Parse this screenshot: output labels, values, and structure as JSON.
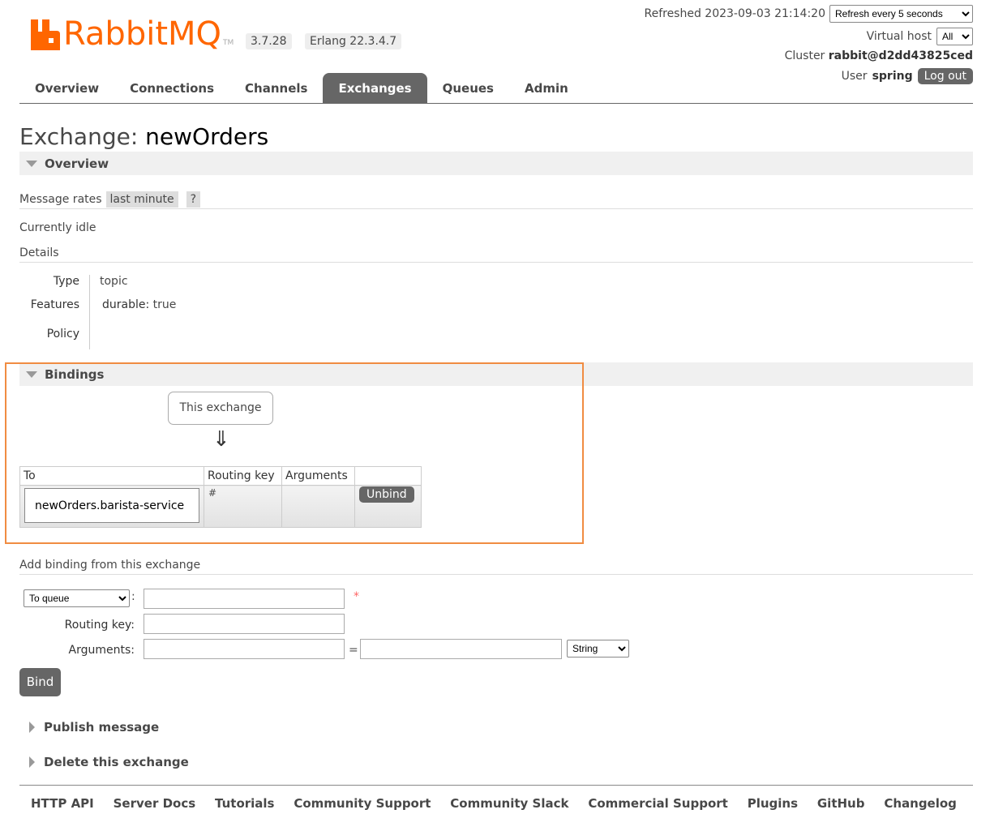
{
  "brand": {
    "name": "RabbitMQ",
    "trademark": "TM",
    "version": "3.7.28",
    "erlang": "Erlang 22.3.4.7",
    "accent": "#ff6600"
  },
  "header": {
    "refreshed_label": "Refreshed 2023-09-03 21:14:20",
    "refresh_select": "Refresh every 5 seconds",
    "vhost_label": "Virtual host",
    "vhost_select": "All",
    "cluster_label": "Cluster",
    "cluster_name": "rabbit@d2dd43825ced",
    "user_label": "User",
    "user_name": "spring",
    "logout": "Log out"
  },
  "tabs": [
    "Overview",
    "Connections",
    "Channels",
    "Exchanges",
    "Queues",
    "Admin"
  ],
  "page": {
    "title_prefix": "Exchange:",
    "title_name": "newOrders"
  },
  "overview": {
    "section_title": "Overview",
    "message_rates_label": "Message rates",
    "message_rates_range": "last minute",
    "help": "?",
    "idle": "Currently idle",
    "details_title": "Details",
    "type_label": "Type",
    "type_value": "topic",
    "features_label": "Features",
    "feature_key": "durable:",
    "feature_value": "true",
    "policy_label": "Policy"
  },
  "bindings": {
    "section_title": "Bindings",
    "this_exchange": "This exchange",
    "arrow": "⇓",
    "columns": [
      "To",
      "Routing key",
      "Arguments",
      ""
    ],
    "rows": [
      {
        "to": "newOrders.barista-service",
        "routing_key": "#",
        "arguments": "",
        "action": "Unbind"
      }
    ]
  },
  "add_binding": {
    "title": "Add binding from this exchange",
    "dest_select": "To queue",
    "colon": ":",
    "required": "*",
    "routing_key_label": "Routing key:",
    "arguments_label": "Arguments:",
    "equals": "=",
    "type_select": "String",
    "bind_button": "Bind"
  },
  "collapsed_sections": [
    "Publish message",
    "Delete this exchange"
  ],
  "footer": [
    "HTTP API",
    "Server Docs",
    "Tutorials",
    "Community Support",
    "Community Slack",
    "Commercial Support",
    "Plugins",
    "GitHub",
    "Changelog"
  ]
}
